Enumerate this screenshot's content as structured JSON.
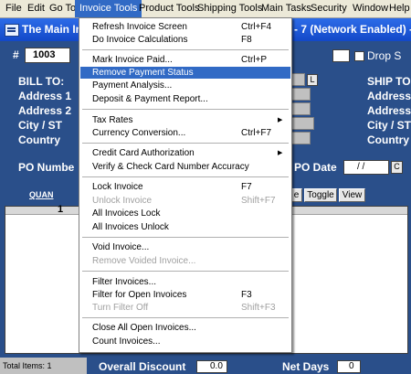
{
  "menubar": {
    "items": [
      "File",
      "Edit",
      "Go To",
      "Invoice Tools",
      "Product Tools",
      "Shipping Tools",
      "Main Tasks",
      "Security",
      "Window",
      "Help"
    ]
  },
  "window": {
    "title_left": "The Main In",
    "title_right": "- 7 (Network Enabled) -"
  },
  "form": {
    "hash_label": "#",
    "invoice_number": "1003",
    "bill_to_label": "BILL TO:",
    "address1_label": "Address 1",
    "address2_label": "Address 2",
    "city_st_label": "City / ST",
    "country_label": "Country",
    "l_button": "L",
    "drop_ship_label": "Drop S",
    "ship_to_label": "SHIP TO",
    "ship_address1_label": "Address",
    "ship_address2_label": "Address",
    "ship_city_label": "City / ST",
    "ship_country_label": "Country",
    "po_number_label": "PO Numbe",
    "po_date_label": "PO Date",
    "po_date_value": "/ /",
    "c_button": "C",
    "quan_label": "QUAN",
    "row1_qty": "1",
    "btn_partial": "e",
    "btn_toggle": "Toggle",
    "btn_view": "View"
  },
  "bottom": {
    "total_items": "Total Items: 1",
    "overall_discount_label": "Overall Discount",
    "overall_discount_value": "0.0",
    "net_days_label": "Net Days",
    "net_days_value": "0"
  },
  "invoice_tools_menu": {
    "refresh": {
      "label": "Refresh Invoice Screen",
      "shortcut": "Ctrl+F4"
    },
    "do_calc": {
      "label": "Do Invoice Calculations",
      "shortcut": "F8"
    },
    "mark_paid": {
      "label": "Mark Invoice Paid...",
      "shortcut": "Ctrl+P"
    },
    "remove_payment": {
      "label": "Remove Payment Status"
    },
    "payment_analysis": {
      "label": "Payment Analysis..."
    },
    "deposit_report": {
      "label": "Deposit & Payment Report..."
    },
    "tax_rates": {
      "label": "Tax Rates"
    },
    "currency": {
      "label": "Currency Conversion...",
      "shortcut": "Ctrl+F7"
    },
    "credit_card": {
      "label": "Credit Card Authorization"
    },
    "verify_card": {
      "label": "Verify & Check Card Number Accuracy"
    },
    "lock_invoice": {
      "label": "Lock Invoice",
      "shortcut": "F7"
    },
    "unlock_invoice": {
      "label": "Unlock Invoice",
      "shortcut": "Shift+F7"
    },
    "all_lock": {
      "label": "All Invoices Lock"
    },
    "all_unlock": {
      "label": "All Invoices Unlock"
    },
    "void_invoice": {
      "label": "Void Invoice..."
    },
    "remove_voided": {
      "label": "Remove Voided Invoice..."
    },
    "filter_invoices": {
      "label": "Filter Invoices..."
    },
    "filter_open": {
      "label": "Filter for Open Invoices",
      "shortcut": "F3"
    },
    "turn_filter_off": {
      "label": "Turn Filter Off",
      "shortcut": "Shift+F3"
    },
    "close_all": {
      "label": "Close All Open Invoices..."
    },
    "count_invoices": {
      "label": "Count Invoices..."
    }
  }
}
